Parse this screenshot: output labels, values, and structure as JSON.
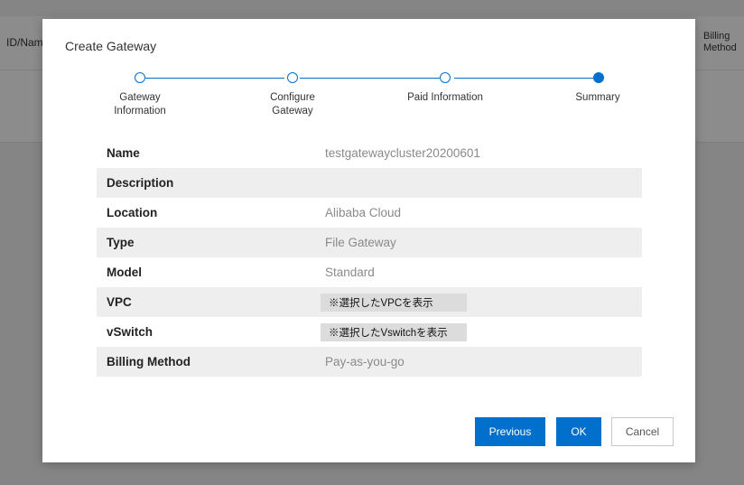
{
  "background": {
    "left_column_header": "ID/Nam",
    "right_column_header": [
      "Billing",
      "Method"
    ]
  },
  "dialog": {
    "title": "Create Gateway",
    "steps": [
      {
        "label_lines": [
          "Gateway",
          "Information"
        ],
        "status": "done"
      },
      {
        "label_lines": [
          "Configure",
          "Gateway"
        ],
        "status": "done"
      },
      {
        "label_lines": [
          "Paid Information"
        ],
        "status": "done"
      },
      {
        "label_lines": [
          "Summary"
        ],
        "status": "active"
      }
    ],
    "summary_rows": [
      {
        "key": "Name",
        "value": "testgatewaycluster20200601",
        "style": "text"
      },
      {
        "key": "Description",
        "value": "",
        "style": "text"
      },
      {
        "key": "Location",
        "value": "Alibaba Cloud",
        "style": "text"
      },
      {
        "key": "Type",
        "value": "File Gateway",
        "style": "text"
      },
      {
        "key": "Model",
        "value": "Standard",
        "style": "text"
      },
      {
        "key": "VPC",
        "value": "※選択したVPCを表示",
        "style": "box"
      },
      {
        "key": "vSwitch",
        "value": "※選択したVswitchを表示",
        "style": "box"
      },
      {
        "key": "Billing Method",
        "value": "Pay-as-you-go",
        "style": "text"
      }
    ],
    "buttons": {
      "previous": "Previous",
      "ok": "OK",
      "cancel": "Cancel"
    }
  },
  "colors": {
    "accent": "#0070cc",
    "row_shade": "#eeeeee",
    "overlay": "rgba(0,0,0,0.45)"
  }
}
